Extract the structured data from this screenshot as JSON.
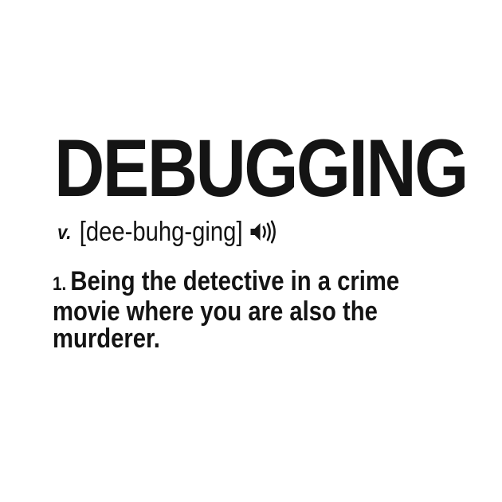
{
  "entry": {
    "word": "DEBUGGING",
    "part_of_speech": "v.",
    "pronunciation": "[dee-buhg-ging]",
    "audio_icon": "speaker-icon"
  },
  "definition": {
    "number": "1.",
    "text": "Being the detective in a crime movie where you are also the murderer."
  },
  "colors": {
    "text": "#141414",
    "background": "#ffffff"
  }
}
